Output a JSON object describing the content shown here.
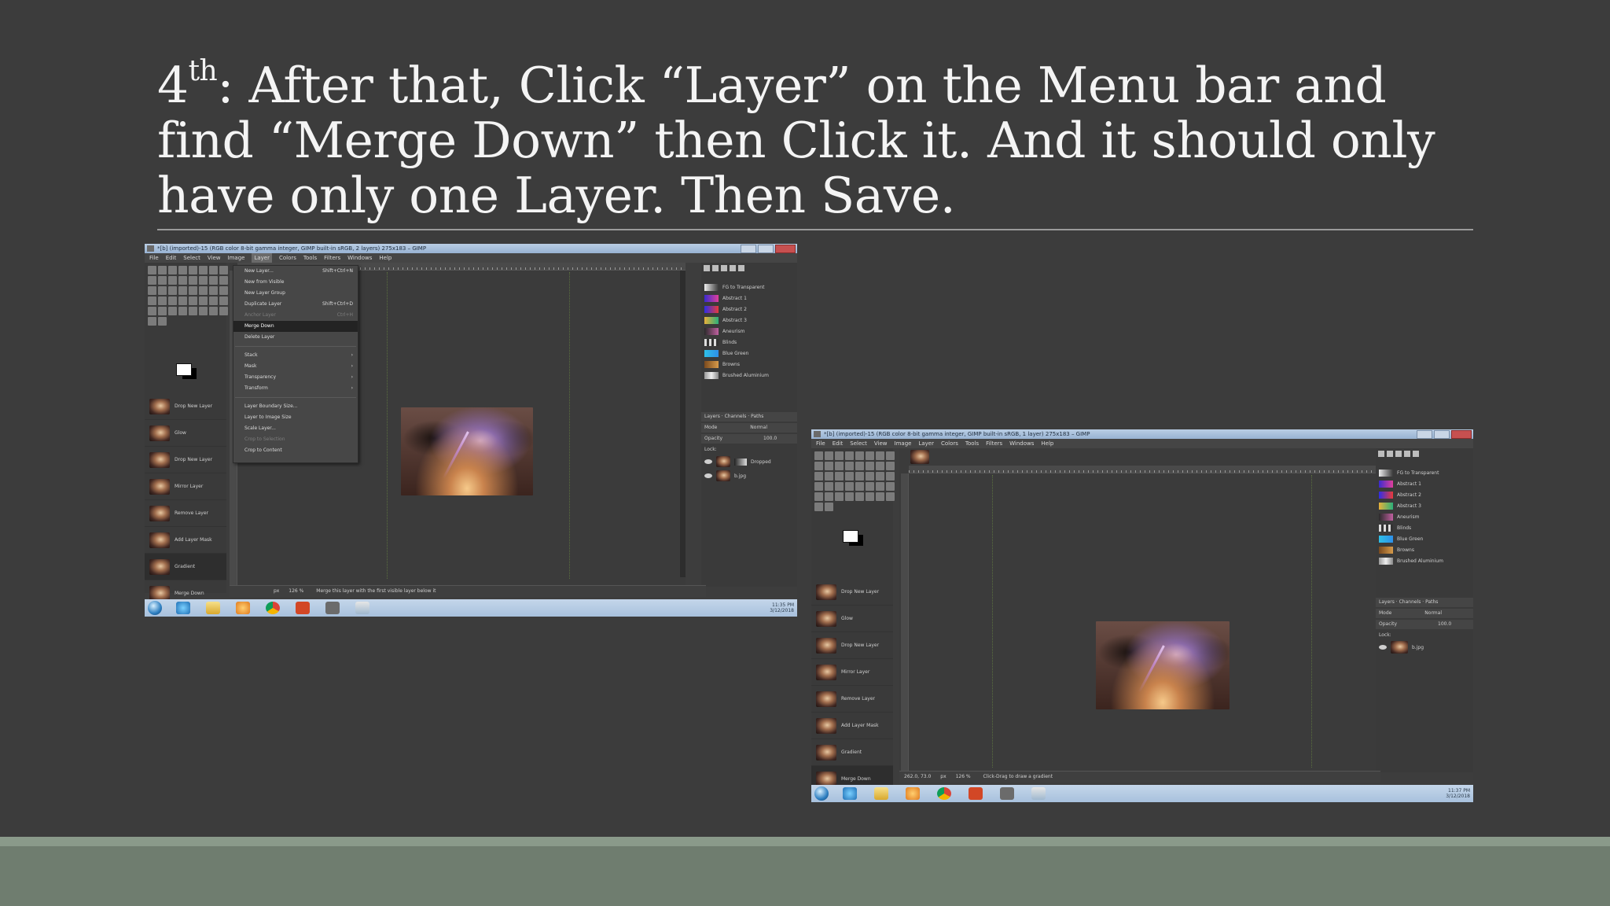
{
  "slide": {
    "title_prefix": "4",
    "title_sup": "th",
    "title_text": ": After that, Click “Layer” on the Menu bar and find “Merge Down” then Click it. And it should only have only one Layer. Then Save."
  },
  "screenshot_left": {
    "window_title": "*[b] (imported)-15 (RGB color 8-bit gamma integer, GIMP built-in sRGB, 2 layers) 275x183 – GIMP",
    "menubar": [
      "File",
      "Edit",
      "Select",
      "View",
      "Image",
      "Layer",
      "Colors",
      "Tools",
      "Filters",
      "Windows",
      "Help"
    ],
    "active_menu": "Layer",
    "layer_menu": {
      "items": [
        {
          "label": "New Layer...",
          "shortcut": "Shift+Ctrl+N",
          "state": "normal"
        },
        {
          "label": "New from Visible",
          "shortcut": "",
          "state": "normal"
        },
        {
          "label": "New Layer Group",
          "shortcut": "",
          "state": "normal"
        },
        {
          "label": "Duplicate Layer",
          "shortcut": "Shift+Ctrl+D",
          "state": "normal"
        },
        {
          "label": "Anchor Layer",
          "shortcut": "Ctrl+H",
          "state": "disabled"
        },
        {
          "label": "Merge Down",
          "shortcut": "",
          "state": "highlighted"
        },
        {
          "label": "Delete Layer",
          "shortcut": "",
          "state": "normal"
        }
      ],
      "submenus": [
        "Stack",
        "Mask",
        "Transparency",
        "Transform"
      ],
      "bottom_items": [
        {
          "label": "Layer Boundary Size...",
          "state": "normal"
        },
        {
          "label": "Layer to Image Size",
          "state": "normal"
        },
        {
          "label": "Scale Layer...",
          "state": "normal"
        },
        {
          "label": "Crop to Selection",
          "state": "disabled"
        },
        {
          "label": "Crop to Content",
          "state": "normal"
        }
      ]
    },
    "history": [
      "Drop New Layer",
      "Glow",
      "Drop New Layer",
      "Mirror Layer",
      "Remove Layer",
      "Add Layer Mask",
      "Gradient",
      "Merge Down"
    ],
    "gradients": [
      "FG to Transparent",
      "Abstract 1",
      "Abstract 2",
      "Abstract 3",
      "Aneurism",
      "Blinds",
      "Blue Green",
      "Browns",
      "Brushed Aluminium"
    ],
    "layers_tab": "Layers",
    "channels_tab": "Channels",
    "paths_tab": "Paths",
    "mode_label": "Mode",
    "mode_value": "Normal",
    "opacity_label": "Opacity",
    "opacity_value": "100.0",
    "lock_label": "Lock:",
    "layer_names": [
      "Dropped",
      "b.jpg"
    ],
    "unit": "px",
    "zoom": "126 %",
    "status_text": "Merge this layer with the first visible layer below it",
    "clock_time": "11:35 PM",
    "clock_date": "3/12/2018"
  },
  "screenshot_right": {
    "window_title": "*[b] (imported)-15 (RGB color 8-bit gamma integer, GIMP built-in sRGB, 1 layer) 275x183 – GIMP",
    "menubar": [
      "File",
      "Edit",
      "Select",
      "View",
      "Image",
      "Layer",
      "Colors",
      "Tools",
      "Filters",
      "Windows",
      "Help"
    ],
    "history": [
      "Drop New Layer",
      "Glow",
      "Drop New Layer",
      "Mirror Layer",
      "Remove Layer",
      "Add Layer Mask",
      "Gradient",
      "Merge Down"
    ],
    "gradients": [
      "FG to Transparent",
      "Abstract 1",
      "Abstract 2",
      "Abstract 3",
      "Aneurism",
      "Blinds",
      "Blue Green",
      "Browns",
      "Brushed Aluminium"
    ],
    "layers_tab": "Layers",
    "channels_tab": "Channels",
    "paths_tab": "Paths",
    "mode_label": "Mode",
    "mode_value": "Normal",
    "opacity_label": "Opacity",
    "opacity_value": "100.0",
    "lock_label": "Lock:",
    "layer_names": [
      "b.jpg"
    ],
    "coords": "262.0, 73.0",
    "unit": "px",
    "zoom": "126 %",
    "status_text": "Click-Drag to draw a gradient",
    "clock_time": "11:37 PM",
    "clock_date": "3/12/2018"
  },
  "colors": {
    "slide_bg": "#3c3c3c",
    "title_text": "#f4f4f4",
    "footer": "#6f7d6f",
    "taskbar": "#a8c1dd"
  }
}
